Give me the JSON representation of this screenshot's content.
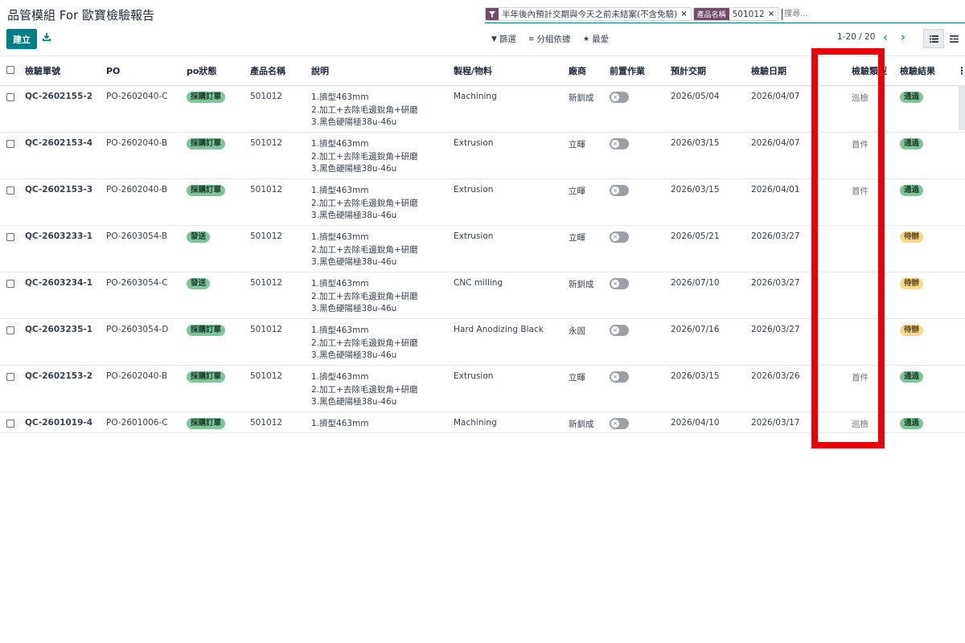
{
  "app": {
    "title": "品管模組 For 歐寶檢驗報告"
  },
  "search": {
    "facets": [
      {
        "label": "",
        "value": "半年後內預計交期與今天之前未結案(不含免驗)"
      },
      {
        "label": "產品名稱",
        "value": "501012"
      }
    ],
    "placeholder": "搜尋..."
  },
  "actions": {
    "create_label": "建立"
  },
  "toolbar": {
    "filter_label": "篩選",
    "group_label": "分組依據",
    "favorite_label": "最愛"
  },
  "pager": {
    "text": "1-20 / 20"
  },
  "table": {
    "columns": [
      "檢驗單號",
      "PO",
      "po狀態",
      "產品名稱",
      "說明",
      "製程/物料",
      "廠商",
      "前置作業",
      "預計交期",
      "檢驗日期",
      "檢驗類型",
      "檢驗結果"
    ],
    "rows": [
      {
        "qc": "QC-2602155-2",
        "po": "PO-2602040-C",
        "po_status": "採購訂單",
        "product": "501012",
        "desc1": "1.擠型463mm",
        "desc2": "2.加工+去除毛邊銳角+研磨",
        "desc3": "3.黑色硬陽極38u-46u",
        "process": "Machining",
        "vendor": "新釧成",
        "prep": false,
        "due": "2026/05/04",
        "insp_date": "2026/04/07",
        "insp_type": "巡檢",
        "result": "通過"
      },
      {
        "qc": "QC-2602153-4",
        "po": "PO-2602040-B",
        "po_status": "採購訂單",
        "product": "501012",
        "desc1": "1.擠型463mm",
        "desc2": "2.加工+去除毛邊銳角+研磨",
        "desc3": "3.黑色硬陽極38u-46u",
        "process": "Extrusion",
        "vendor": "立暉",
        "prep": false,
        "due": "2026/03/15",
        "insp_date": "2026/04/07",
        "insp_type": "首件",
        "result": "通過"
      },
      {
        "qc": "QC-2602153-3",
        "po": "PO-2602040-B",
        "po_status": "採購訂單",
        "product": "501012",
        "desc1": "1.擠型463mm",
        "desc2": "2.加工+去除毛邊銳角+研磨",
        "desc3": "3.黑色硬陽極38u-46u",
        "process": "Extrusion",
        "vendor": "立暉",
        "prep": false,
        "due": "2026/03/15",
        "insp_date": "2026/04/01",
        "insp_type": "首件",
        "result": "通過"
      },
      {
        "qc": "QC-2603233-1",
        "po": "PO-2603054-B",
        "po_status": "發送",
        "product": "501012",
        "desc1": "1.擠型463mm",
        "desc2": "2.加工+去除毛邊銳角+研磨",
        "desc3": "3.黑色硬陽極38u-46u",
        "process": "Extrusion",
        "vendor": "立暉",
        "prep": false,
        "due": "2026/05/21",
        "insp_date": "2026/03/27",
        "insp_type": "",
        "result": "待辦"
      },
      {
        "qc": "QC-2603234-1",
        "po": "PO-2603054-C",
        "po_status": "發送",
        "product": "501012",
        "desc1": "1.擠型463mm",
        "desc2": "2.加工+去除毛邊銳角+研磨",
        "desc3": "3.黑色硬陽極38u-46u",
        "process": "CNC milling",
        "vendor": "新釧成",
        "prep": false,
        "due": "2026/07/10",
        "insp_date": "2026/03/27",
        "insp_type": "",
        "result": "待辦"
      },
      {
        "qc": "QC-2603235-1",
        "po": "PO-2603054-D",
        "po_status": "採購訂單",
        "product": "501012",
        "desc1": "1.擠型463mm",
        "desc2": "2.加工+去除毛邊銳角+研磨",
        "desc3": "3.黑色硬陽極38u-46u",
        "process": "Hard Anodizing Black",
        "vendor": "永固",
        "prep": false,
        "due": "2026/07/16",
        "insp_date": "2026/03/27",
        "insp_type": "",
        "result": "待辦"
      },
      {
        "qc": "QC-2602153-2",
        "po": "PO-2602040-B",
        "po_status": "採購訂單",
        "product": "501012",
        "desc1": "1.擠型463mm",
        "desc2": "2.加工+去除毛邊銳角+研磨",
        "desc3": "3.黑色硬陽極38u-46u",
        "process": "Extrusion",
        "vendor": "立暉",
        "prep": false,
        "due": "2026/03/15",
        "insp_date": "2026/03/26",
        "insp_type": "首件",
        "result": "通過"
      },
      {
        "qc": "QC-2601019-4",
        "po": "PO-2601006-C",
        "po_status": "採購訂單",
        "product": "501012",
        "desc1": "1.擠型463mm",
        "desc2": "",
        "desc3": "",
        "process": "Machining",
        "vendor": "新釧成",
        "prep": false,
        "due": "2026/04/10",
        "insp_date": "2026/03/17",
        "insp_type": "巡檢",
        "result": "通過"
      }
    ]
  },
  "colors": {
    "primary": "#017e84",
    "facet_tag": "#714b67",
    "badge_green": "#7cc69a",
    "badge_yellow": "#f7d98b",
    "highlight": "#e8000b"
  },
  "icons": {
    "filter_facet": "funnel-icon",
    "download": "download-icon",
    "filter": "funnel-icon",
    "group": "list-lines-icon",
    "favorite": "star-icon",
    "prev": "chevron-left-icon",
    "next": "chevron-right-icon",
    "view_list": "list-view-icon",
    "view_other": "pivot-view-icon",
    "column_options": "vertical-dots-icon"
  }
}
